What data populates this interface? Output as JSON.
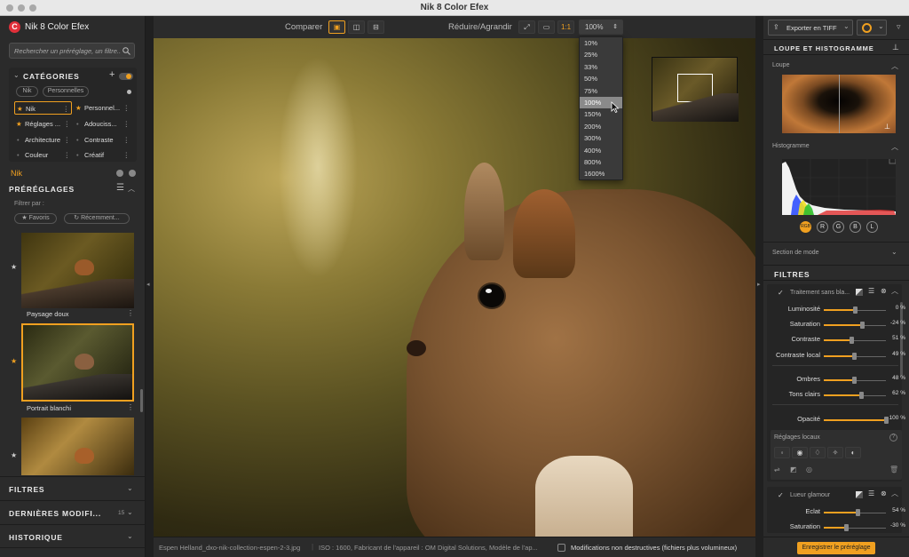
{
  "window": {
    "title": "Nik 8 Color Efex"
  },
  "app": {
    "name": "Nik 8 Color Efex",
    "logo_letter": "C"
  },
  "search": {
    "placeholder": "Rechercher un préréglage, un filtre..."
  },
  "categories": {
    "title": "CATÉGORIES",
    "tabs": [
      "Nik",
      "Personnelles"
    ],
    "items": [
      {
        "label": "Nik",
        "star": true,
        "selected": true
      },
      {
        "label": "Personnel...",
        "star": true
      },
      {
        "label": "Réglages ...",
        "star": true
      },
      {
        "label": "Adouciss..."
      },
      {
        "label": "Architecture"
      },
      {
        "label": "Contraste"
      },
      {
        "label": "Couleur"
      },
      {
        "label": "Créatif"
      }
    ],
    "current": "Nik"
  },
  "presets": {
    "title": "PRÉRÉGLAGES",
    "filter_label": "Filtrer par :",
    "filter_favorites": "Favoris",
    "filter_recent": "Récemment...",
    "items": [
      {
        "name": "Paysage doux",
        "favorite": false
      },
      {
        "name": "Portrait blanchi",
        "favorite": true,
        "selected": true
      },
      {
        "name": "",
        "favorite": false
      }
    ]
  },
  "left_sections": [
    {
      "title": "FILTRES",
      "count": ""
    },
    {
      "title": "DERNIÈRES MODIFI...",
      "count": "15"
    },
    {
      "title": "HISTORIQUE",
      "count": ""
    }
  ],
  "toolbar": {
    "compare_label": "Comparer",
    "zoom_label": "Réduire/Agrandir",
    "one_to_one": "1:1",
    "zoom_value": "100%"
  },
  "zoom_dropdown": {
    "options": [
      "10%",
      "25%",
      "33%",
      "50%",
      "75%",
      "100%",
      "150%",
      "200%",
      "300%",
      "400%",
      "800%",
      "1600%"
    ],
    "selected": "100%"
  },
  "status": {
    "filename": "Espen Helland_dxo-nik-collection-espen-2-3.jpg",
    "meta": "ISO : 1600, Fabricant de l'appareil : OM Digital Solutions, Modèle de l'ap...",
    "nondestructive": "Modifications non destructives (fichiers plus volumineux)"
  },
  "right": {
    "export_label": "Exporter en TIFF",
    "loupe_section": "LOUPE ET HISTOGRAMME",
    "loupe_label": "Loupe",
    "histogram_label": "Histogramme",
    "channels": [
      "RGB",
      "R",
      "G",
      "B",
      "L"
    ],
    "mode_section": "Section de mode",
    "filters_title": "FILTRES",
    "filter1": {
      "name": "Traitement sans bla...",
      "sliders": [
        {
          "label": "Luminosité",
          "value": "0 %",
          "level": 0.5
        },
        {
          "label": "Saturation",
          "value": "-24 %",
          "level": 0.62
        },
        {
          "label": "Contraste",
          "value": "51 %",
          "level": 0.44
        },
        {
          "label": "Contraste local",
          "value": "49 %",
          "level": 0.48
        },
        {
          "label": "Ombres",
          "value": "48 %",
          "level": 0.48
        },
        {
          "label": "Tons clairs",
          "value": "62 %",
          "level": 0.6
        },
        {
          "label": "Opacité",
          "value": "100 %",
          "level": 1.0
        }
      ]
    },
    "local_label": "Réglages locaux",
    "filter2": {
      "name": "Lueur glamour",
      "sliders": [
        {
          "label": "Eclat",
          "value": "54 %",
          "level": 0.54
        },
        {
          "label": "Saturation",
          "value": "-30 %",
          "level": 0.35
        }
      ]
    },
    "save_preset": "Enregistrer le préréglage"
  },
  "colors": {
    "accent": "#f0a020",
    "brand": "#e0303a"
  }
}
